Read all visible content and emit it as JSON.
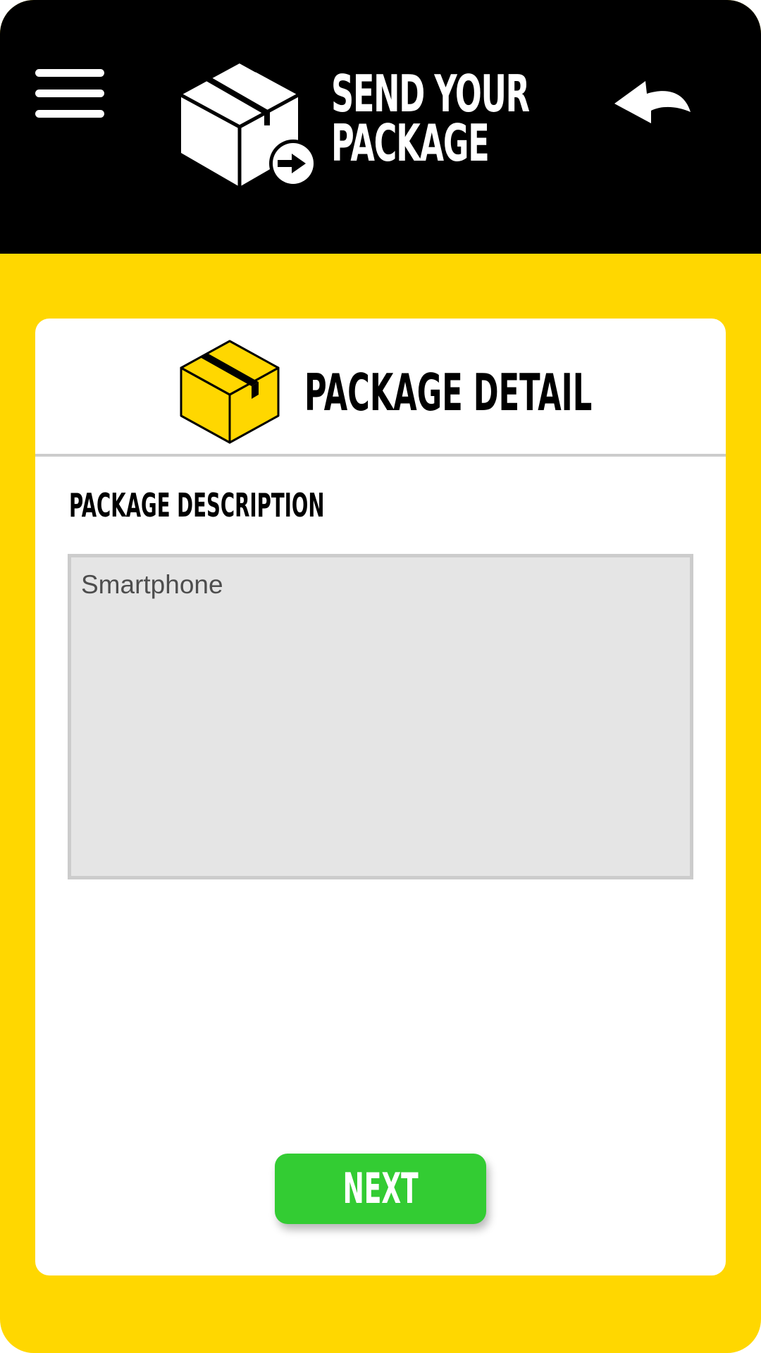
{
  "header": {
    "title_line1": "SEND YOUR",
    "title_line2": "PACKAGE",
    "menu_icon": "hamburger-menu-icon",
    "brand_icon": "package-send-icon",
    "back_icon": "back-arrow-icon"
  },
  "card": {
    "title": "PACKAGE DETAIL",
    "icon": "package-box-icon",
    "field_label": "PACKAGE DESCRIPTION",
    "description_value": "Smartphone"
  },
  "actions": {
    "next_label": "NEXT"
  },
  "colors": {
    "background": "#FFD700",
    "header": "#000000",
    "accent": "#33CC33",
    "input_bg": "#E5E5E5",
    "border": "#CCCCCC"
  }
}
